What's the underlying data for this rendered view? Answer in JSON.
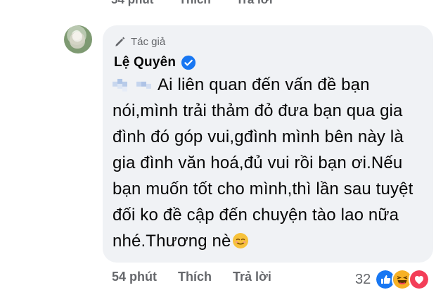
{
  "top_actions": {
    "time": "54 phút",
    "like": "Thích",
    "reply": "Trả lời"
  },
  "comment": {
    "author_badge": "Tác giả",
    "author_name": "Lệ Quyên",
    "text": "Ai liên quan đến vấn đề bạn nói,mình trải thảm đỏ đưa bạn qua gia đình đó góp vui,gđình mình bên này là gia đình văn hoá,đủ vui rồi bạn ơi.Nếu bạn muốn tốt cho mình,thì lần sau tuyệt đối ko đề cập đến chuyện tào lao nữa nhé.Thương nè",
    "time": "54 phút",
    "like": "Thích",
    "reply": "Trả lời",
    "reaction_count": "32"
  },
  "icons": [
    "pen-icon",
    "verified-badge-icon",
    "smiling-emoji-icon",
    "like-reaction-icon",
    "haha-reaction-icon",
    "love-reaction-icon"
  ],
  "colors": {
    "bubble_bg": "#f0f2f5",
    "secondary_text": "#65676b",
    "verified_blue": "#1877f2",
    "love_red": "#f33e58",
    "haha_yellow": "#f7b125"
  }
}
